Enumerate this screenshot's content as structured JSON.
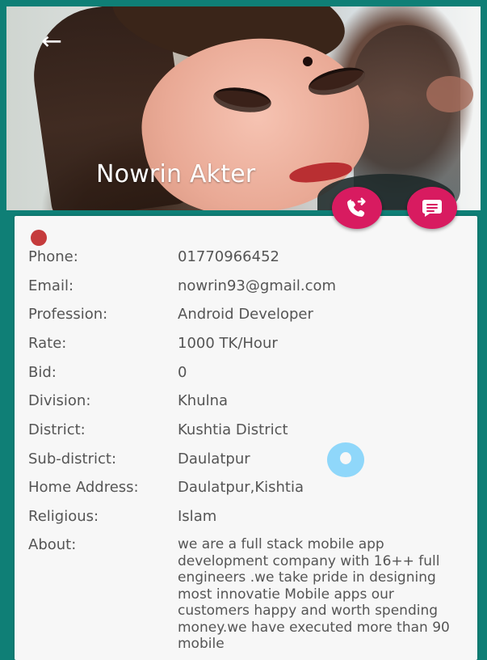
{
  "profile": {
    "name": "Nowrin Akter"
  },
  "actions": {
    "call_icon": "phone-forward-icon",
    "message_icon": "message-icon"
  },
  "details": {
    "status_color": "#c53b3c",
    "phone": {
      "label": "Phone:",
      "value": "01770966452"
    },
    "email": {
      "label": "Email:",
      "value": "nowrin93@gmail.com"
    },
    "profession": {
      "label": "Profession:",
      "value": "Android Developer"
    },
    "rate": {
      "label": "Rate:",
      "value": "1000 TK/Hour"
    },
    "bid": {
      "label": "Bid:",
      "value": "0"
    },
    "division": {
      "label": "Division:",
      "value": "Khulna"
    },
    "district": {
      "label": "District:",
      "value": "Kushtia District"
    },
    "sub_district": {
      "label": "Sub-district:",
      "value": "Daulatpur"
    },
    "home_address": {
      "label": "Home Address:",
      "value": "Daulatpur,Kishtia"
    },
    "religious": {
      "label": "Religious:",
      "value": "Islam"
    },
    "about": {
      "label": "About:",
      "value": "we are a full stack mobile app development company with 16++ full engineers .we take pride in designing most innovatie Mobile apps our customers happy and worth spending money.we have executed more than 90 mobile"
    }
  },
  "colors": {
    "header_border": "#0f7f76",
    "fab": "#d81b60",
    "card_background": "#f7f7f7",
    "text": "#555555",
    "touch_indicator": "#89d5fa"
  }
}
